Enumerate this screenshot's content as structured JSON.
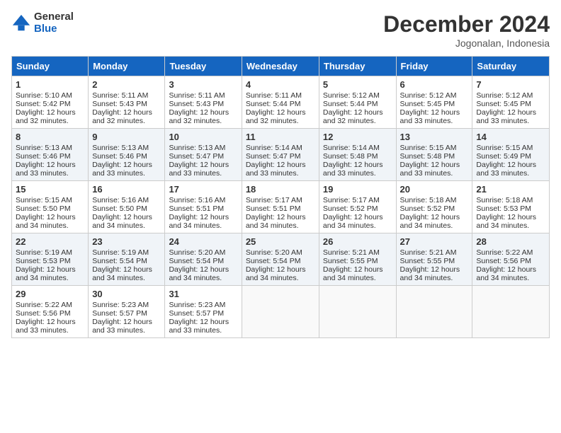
{
  "header": {
    "logo_general": "General",
    "logo_blue": "Blue",
    "month_year": "December 2024",
    "location": "Jogonalan, Indonesia"
  },
  "weekdays": [
    "Sunday",
    "Monday",
    "Tuesday",
    "Wednesday",
    "Thursday",
    "Friday",
    "Saturday"
  ],
  "weeks": [
    [
      {
        "day": "1",
        "sunrise": "5:10 AM",
        "sunset": "5:42 PM",
        "daylight": "12 hours and 32 minutes."
      },
      {
        "day": "2",
        "sunrise": "5:11 AM",
        "sunset": "5:43 PM",
        "daylight": "12 hours and 32 minutes."
      },
      {
        "day": "3",
        "sunrise": "5:11 AM",
        "sunset": "5:43 PM",
        "daylight": "12 hours and 32 minutes."
      },
      {
        "day": "4",
        "sunrise": "5:11 AM",
        "sunset": "5:44 PM",
        "daylight": "12 hours and 32 minutes."
      },
      {
        "day": "5",
        "sunrise": "5:12 AM",
        "sunset": "5:44 PM",
        "daylight": "12 hours and 32 minutes."
      },
      {
        "day": "6",
        "sunrise": "5:12 AM",
        "sunset": "5:45 PM",
        "daylight": "12 hours and 33 minutes."
      },
      {
        "day": "7",
        "sunrise": "5:12 AM",
        "sunset": "5:45 PM",
        "daylight": "12 hours and 33 minutes."
      }
    ],
    [
      {
        "day": "8",
        "sunrise": "5:13 AM",
        "sunset": "5:46 PM",
        "daylight": "12 hours and 33 minutes."
      },
      {
        "day": "9",
        "sunrise": "5:13 AM",
        "sunset": "5:46 PM",
        "daylight": "12 hours and 33 minutes."
      },
      {
        "day": "10",
        "sunrise": "5:13 AM",
        "sunset": "5:47 PM",
        "daylight": "12 hours and 33 minutes."
      },
      {
        "day": "11",
        "sunrise": "5:14 AM",
        "sunset": "5:47 PM",
        "daylight": "12 hours and 33 minutes."
      },
      {
        "day": "12",
        "sunrise": "5:14 AM",
        "sunset": "5:48 PM",
        "daylight": "12 hours and 33 minutes."
      },
      {
        "day": "13",
        "sunrise": "5:15 AM",
        "sunset": "5:48 PM",
        "daylight": "12 hours and 33 minutes."
      },
      {
        "day": "14",
        "sunrise": "5:15 AM",
        "sunset": "5:49 PM",
        "daylight": "12 hours and 33 minutes."
      }
    ],
    [
      {
        "day": "15",
        "sunrise": "5:15 AM",
        "sunset": "5:50 PM",
        "daylight": "12 hours and 34 minutes."
      },
      {
        "day": "16",
        "sunrise": "5:16 AM",
        "sunset": "5:50 PM",
        "daylight": "12 hours and 34 minutes."
      },
      {
        "day": "17",
        "sunrise": "5:16 AM",
        "sunset": "5:51 PM",
        "daylight": "12 hours and 34 minutes."
      },
      {
        "day": "18",
        "sunrise": "5:17 AM",
        "sunset": "5:51 PM",
        "daylight": "12 hours and 34 minutes."
      },
      {
        "day": "19",
        "sunrise": "5:17 AM",
        "sunset": "5:52 PM",
        "daylight": "12 hours and 34 minutes."
      },
      {
        "day": "20",
        "sunrise": "5:18 AM",
        "sunset": "5:52 PM",
        "daylight": "12 hours and 34 minutes."
      },
      {
        "day": "21",
        "sunrise": "5:18 AM",
        "sunset": "5:53 PM",
        "daylight": "12 hours and 34 minutes."
      }
    ],
    [
      {
        "day": "22",
        "sunrise": "5:19 AM",
        "sunset": "5:53 PM",
        "daylight": "12 hours and 34 minutes."
      },
      {
        "day": "23",
        "sunrise": "5:19 AM",
        "sunset": "5:54 PM",
        "daylight": "12 hours and 34 minutes."
      },
      {
        "day": "24",
        "sunrise": "5:20 AM",
        "sunset": "5:54 PM",
        "daylight": "12 hours and 34 minutes."
      },
      {
        "day": "25",
        "sunrise": "5:20 AM",
        "sunset": "5:54 PM",
        "daylight": "12 hours and 34 minutes."
      },
      {
        "day": "26",
        "sunrise": "5:21 AM",
        "sunset": "5:55 PM",
        "daylight": "12 hours and 34 minutes."
      },
      {
        "day": "27",
        "sunrise": "5:21 AM",
        "sunset": "5:55 PM",
        "daylight": "12 hours and 34 minutes."
      },
      {
        "day": "28",
        "sunrise": "5:22 AM",
        "sunset": "5:56 PM",
        "daylight": "12 hours and 34 minutes."
      }
    ],
    [
      {
        "day": "29",
        "sunrise": "5:22 AM",
        "sunset": "5:56 PM",
        "daylight": "12 hours and 33 minutes."
      },
      {
        "day": "30",
        "sunrise": "5:23 AM",
        "sunset": "5:57 PM",
        "daylight": "12 hours and 33 minutes."
      },
      {
        "day": "31",
        "sunrise": "5:23 AM",
        "sunset": "5:57 PM",
        "daylight": "12 hours and 33 minutes."
      },
      null,
      null,
      null,
      null
    ]
  ],
  "labels": {
    "sunrise": "Sunrise:",
    "sunset": "Sunset:",
    "daylight": "Daylight:"
  }
}
